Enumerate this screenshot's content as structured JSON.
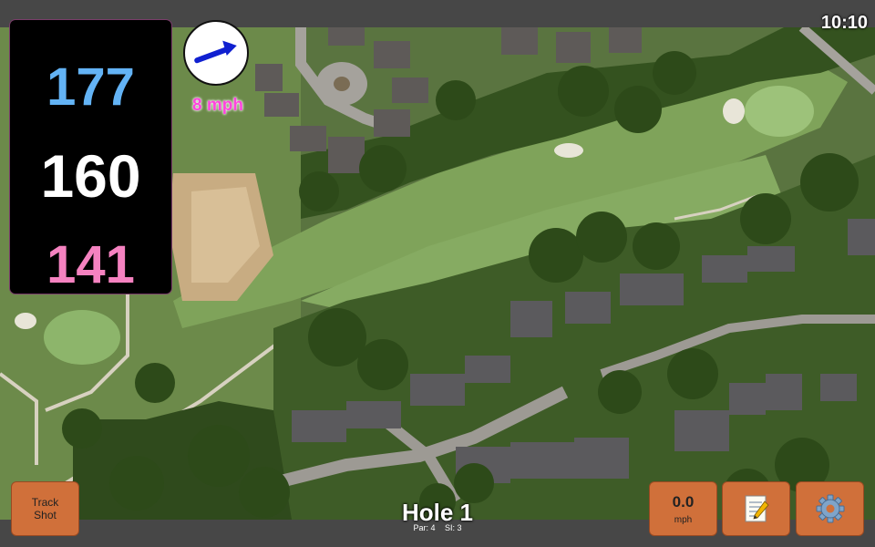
{
  "status": {
    "time": "10:10"
  },
  "yardages": {
    "back": "177",
    "middle": "160",
    "front": "141"
  },
  "wind": {
    "speed_label": "8 mph",
    "direction_deg": 70
  },
  "buttons": {
    "track_shot_line1": "Track",
    "track_shot_line2": "Shot",
    "speed_value": "0.0",
    "speed_unit": "mph",
    "notes_icon": "notes-icon",
    "settings_icon": "gear-icon"
  },
  "hole": {
    "title": "Hole 1",
    "par": "Par: 4",
    "si": "SI: 3"
  },
  "colors": {
    "back_yardage": "#63b3f5",
    "middle_yardage": "#ffffff",
    "front_yardage": "#f582c0",
    "wind_text": "#ff44dd",
    "button_bg": "#d0703a",
    "wind_arrow": "#1020d0"
  }
}
